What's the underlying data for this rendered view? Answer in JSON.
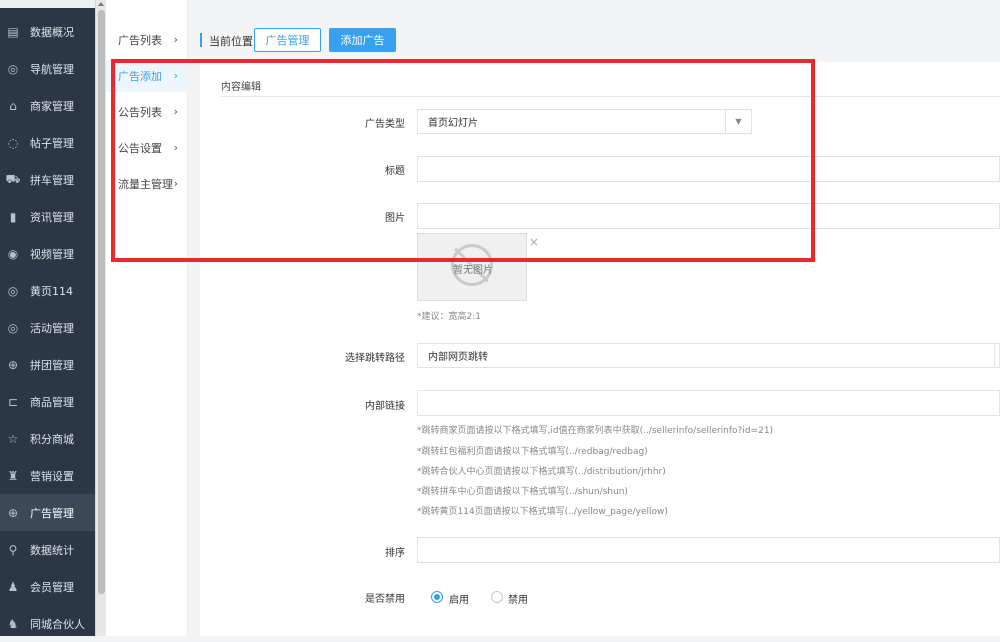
{
  "sidebar": {
    "items": [
      {
        "icon": "dashboard-icon",
        "glyph": "▤",
        "label": "数据概况"
      },
      {
        "icon": "compass-icon",
        "glyph": "◎",
        "label": "导航管理"
      },
      {
        "icon": "bank-icon",
        "glyph": "⌂",
        "label": "商家管理"
      },
      {
        "icon": "comment-icon",
        "glyph": "◌",
        "label": "帖子管理"
      },
      {
        "icon": "car-icon",
        "glyph": "⛟",
        "label": "拼车管理"
      },
      {
        "icon": "book-icon",
        "glyph": "▮",
        "label": "资讯管理"
      },
      {
        "icon": "video-icon",
        "glyph": "◉",
        "label": "视频管理"
      },
      {
        "icon": "yellowpage-icon",
        "glyph": "◎",
        "label": "黄页114"
      },
      {
        "icon": "activity-icon",
        "glyph": "◎",
        "label": "活动管理"
      },
      {
        "icon": "group-icon",
        "glyph": "⊕",
        "label": "拼团管理"
      },
      {
        "icon": "cart-icon",
        "glyph": "⊏",
        "label": "商品管理"
      },
      {
        "icon": "star-icon",
        "glyph": "☆",
        "label": "积分商城"
      },
      {
        "icon": "gift-icon",
        "glyph": "♜",
        "label": "营销设置"
      },
      {
        "icon": "ad-icon",
        "glyph": "⊕",
        "label": "广告管理"
      },
      {
        "icon": "stats-icon",
        "glyph": "⚲",
        "label": "数据统计"
      },
      {
        "icon": "user-icon",
        "glyph": "♟",
        "label": "会员管理"
      },
      {
        "icon": "partner-icon",
        "glyph": "♞",
        "label": "同城合伙人"
      }
    ],
    "active_index": 13
  },
  "subnav": {
    "items": [
      {
        "label": "广告列表"
      },
      {
        "label": "广告添加"
      },
      {
        "label": "公告列表"
      },
      {
        "label": "公告设置"
      },
      {
        "label": "流量主管理"
      }
    ],
    "chevron": "›",
    "active_index": 1
  },
  "breadcrumb": {
    "label": "当前位置:",
    "link": "广告管理",
    "current": "添加广告"
  },
  "form": {
    "section_title": "内容编辑",
    "ad_type": {
      "label": "广告类型",
      "value": "首页幻灯片"
    },
    "title": {
      "label": "标题",
      "value": ""
    },
    "image": {
      "label": "图片",
      "value": "",
      "placeholder_text": "暂无图片",
      "close": "×",
      "hint": "*建议：宽高2:1"
    },
    "jump_path": {
      "label": "选择跳转路径",
      "value": "内部网页跳转"
    },
    "internal_link": {
      "label": "内部链接",
      "value": "",
      "hints": [
        "*跳转商家页面请按以下格式填写,id值在商家列表中获取(../sellerinfo/sellerinfo?id=21)",
        "*跳转红包福利页面请按以下格式填写(../redbag/redbag)",
        "*跳转合伙人中心页面请按以下格式填写(../distribution/jrhhr)",
        "*跳转拼车中心页面请按以下格式填写(../shun/shun)",
        "*跳转黄页114页面请按以下格式填写(../yellow_page/yellow)"
      ]
    },
    "sort": {
      "label": "排序",
      "value": ""
    },
    "disabled": {
      "label": "是否禁用",
      "options": [
        {
          "label": "启用",
          "checked": true
        },
        {
          "label": "禁用",
          "checked": false
        }
      ]
    }
  },
  "colors": {
    "accent": "#35a1ef",
    "sidebar_bg": "#2b3744",
    "highlight": "#e8292f"
  }
}
